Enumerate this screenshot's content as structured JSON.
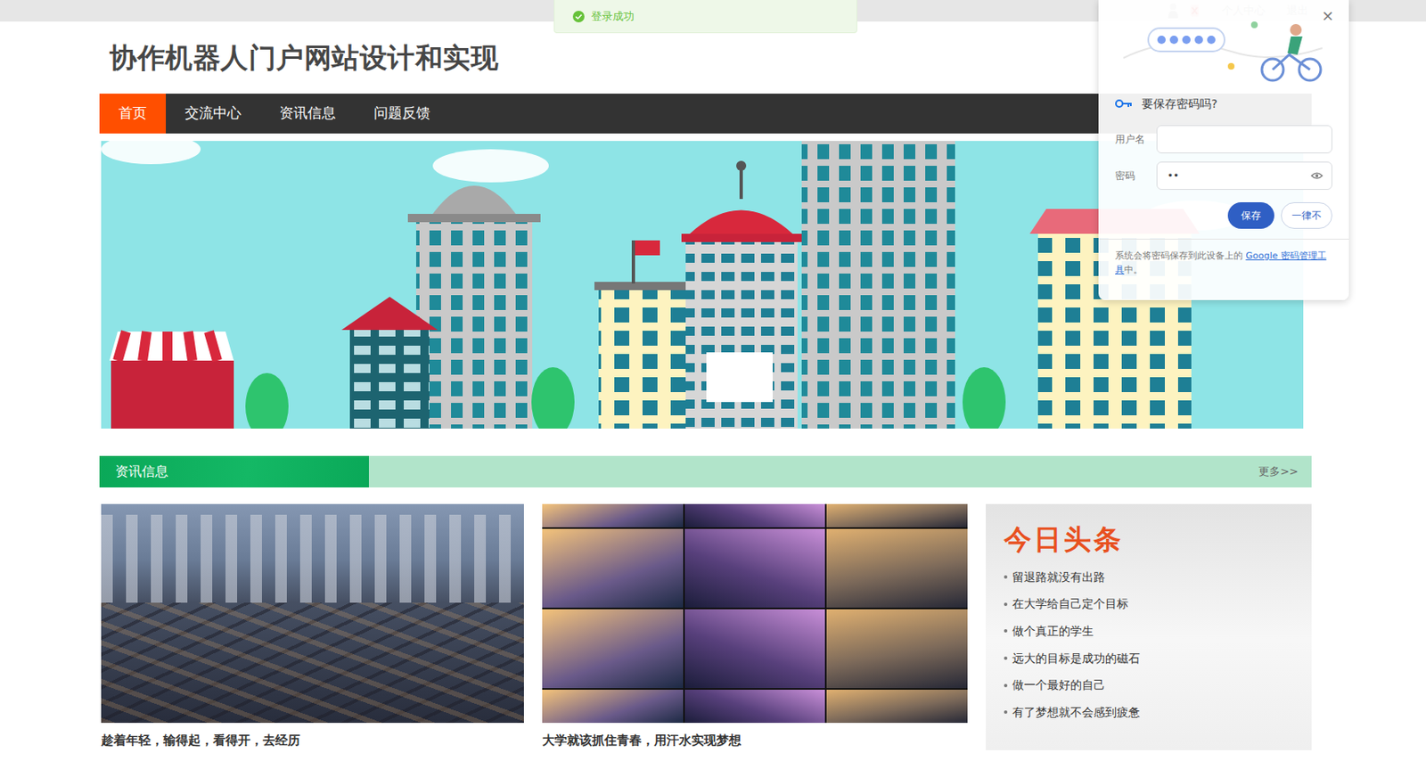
{
  "toast": {
    "text": "登录成功"
  },
  "user_menu": {
    "links": [
      "个人中心",
      "退出"
    ]
  },
  "site_title": "协作机器人门户网站设计和实现",
  "nav": [
    {
      "label": "首页",
      "selected": true
    },
    {
      "label": "交流中心",
      "selected": false
    },
    {
      "label": "资讯信息",
      "selected": false
    },
    {
      "label": "问题反馈",
      "selected": false
    }
  ],
  "password_prompt": {
    "close": "×",
    "title": "要保存密码吗?",
    "username_label": "用户名",
    "password_label": "密码",
    "password_value": "••",
    "buttons": [
      "保存",
      "一律不"
    ],
    "footer_before": "系统会将密码保存到此设备上的 ",
    "footer_link": "Google 密码管理工具",
    "footer_after": "中。"
  },
  "section": {
    "title": "资讯信息",
    "more": "更多>>"
  },
  "articles": [
    {
      "caption": "趁着年轻，输得起，看得开，去经历",
      "kind": "photo"
    },
    {
      "caption": "大学就该抓住青春，用汗水实现梦想",
      "kind": "collage"
    }
  ],
  "headlines": {
    "title": "今日头条",
    "items": [
      "留退路就没有出路",
      "在大学给自己定个目标",
      "做个真正的学生",
      "远大的目标是成功的磁石",
      "做一个最好的自己",
      "有了梦想就不会感到疲惫"
    ]
  }
}
